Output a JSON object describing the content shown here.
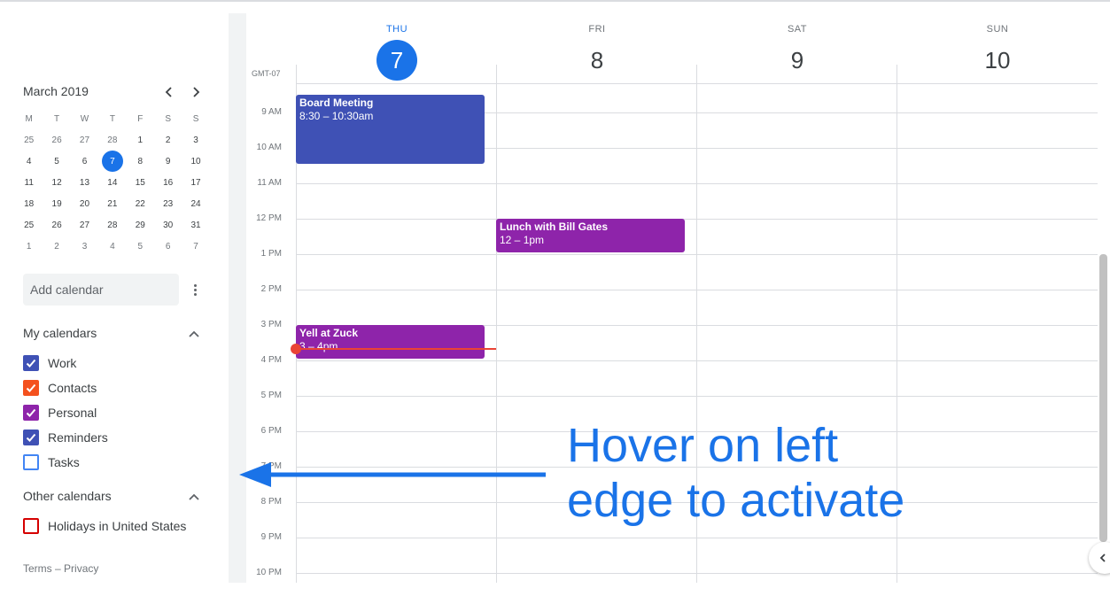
{
  "mini_calendar": {
    "title": "March 2019",
    "weekdays": [
      "M",
      "T",
      "W",
      "T",
      "F",
      "S",
      "S"
    ],
    "weeks": [
      [
        "25",
        "26",
        "27",
        "28",
        "1",
        "2",
        "3"
      ],
      [
        "4",
        "5",
        "6",
        "7",
        "8",
        "9",
        "10"
      ],
      [
        "11",
        "12",
        "13",
        "14",
        "15",
        "16",
        "17"
      ],
      [
        "18",
        "19",
        "20",
        "21",
        "22",
        "23",
        "24"
      ],
      [
        "25",
        "26",
        "27",
        "28",
        "29",
        "30",
        "31"
      ],
      [
        "1",
        "2",
        "3",
        "4",
        "5",
        "6",
        "7"
      ]
    ],
    "today": "7"
  },
  "add_calendar": {
    "placeholder": "Add calendar"
  },
  "my_calendars": {
    "title": "My calendars",
    "items": [
      {
        "label": "Work",
        "color": "#3f51b5",
        "checked": true
      },
      {
        "label": "Contacts",
        "color": "#f4511e",
        "checked": true
      },
      {
        "label": "Personal",
        "color": "#8e24aa",
        "checked": true
      },
      {
        "label": "Reminders",
        "color": "#3f51b5",
        "checked": true
      },
      {
        "label": "Tasks",
        "color": "#4285f4",
        "checked": false
      }
    ]
  },
  "other_calendars": {
    "title": "Other calendars",
    "items": [
      {
        "label": "Holidays in United States",
        "color": "#d50000",
        "checked": false
      }
    ]
  },
  "footer": {
    "terms": "Terms",
    "sep": "–",
    "privacy": "Privacy"
  },
  "week_view": {
    "timezone": "GMT-07",
    "days": [
      {
        "dow": "THU",
        "num": "7",
        "today": true
      },
      {
        "dow": "FRI",
        "num": "8",
        "today": false
      },
      {
        "dow": "SAT",
        "num": "9",
        "today": false
      },
      {
        "dow": "SUN",
        "num": "10",
        "today": false
      }
    ],
    "hours": [
      "9 AM",
      "10 AM",
      "11 AM",
      "12 PM",
      "1 PM",
      "2 PM",
      "3 PM",
      "4 PM",
      "5 PM",
      "6 PM",
      "7 PM",
      "8 PM",
      "9 PM",
      "10 PM"
    ],
    "events": [
      {
        "title": "Board Meeting",
        "time": "8:30 – 10:30am",
        "color": "#3f51b5"
      },
      {
        "title": "Lunch with Bill Gates",
        "time": "12 – 1pm",
        "color": "#8e24aa"
      },
      {
        "title": "Yell at Zuck",
        "time": "3 – 4pm",
        "color": "#8e24aa"
      }
    ],
    "now_color": "#ea4335"
  },
  "annotation": {
    "line1": "Hover on left",
    "line2": "edge to activate",
    "color": "#1a73e8"
  }
}
